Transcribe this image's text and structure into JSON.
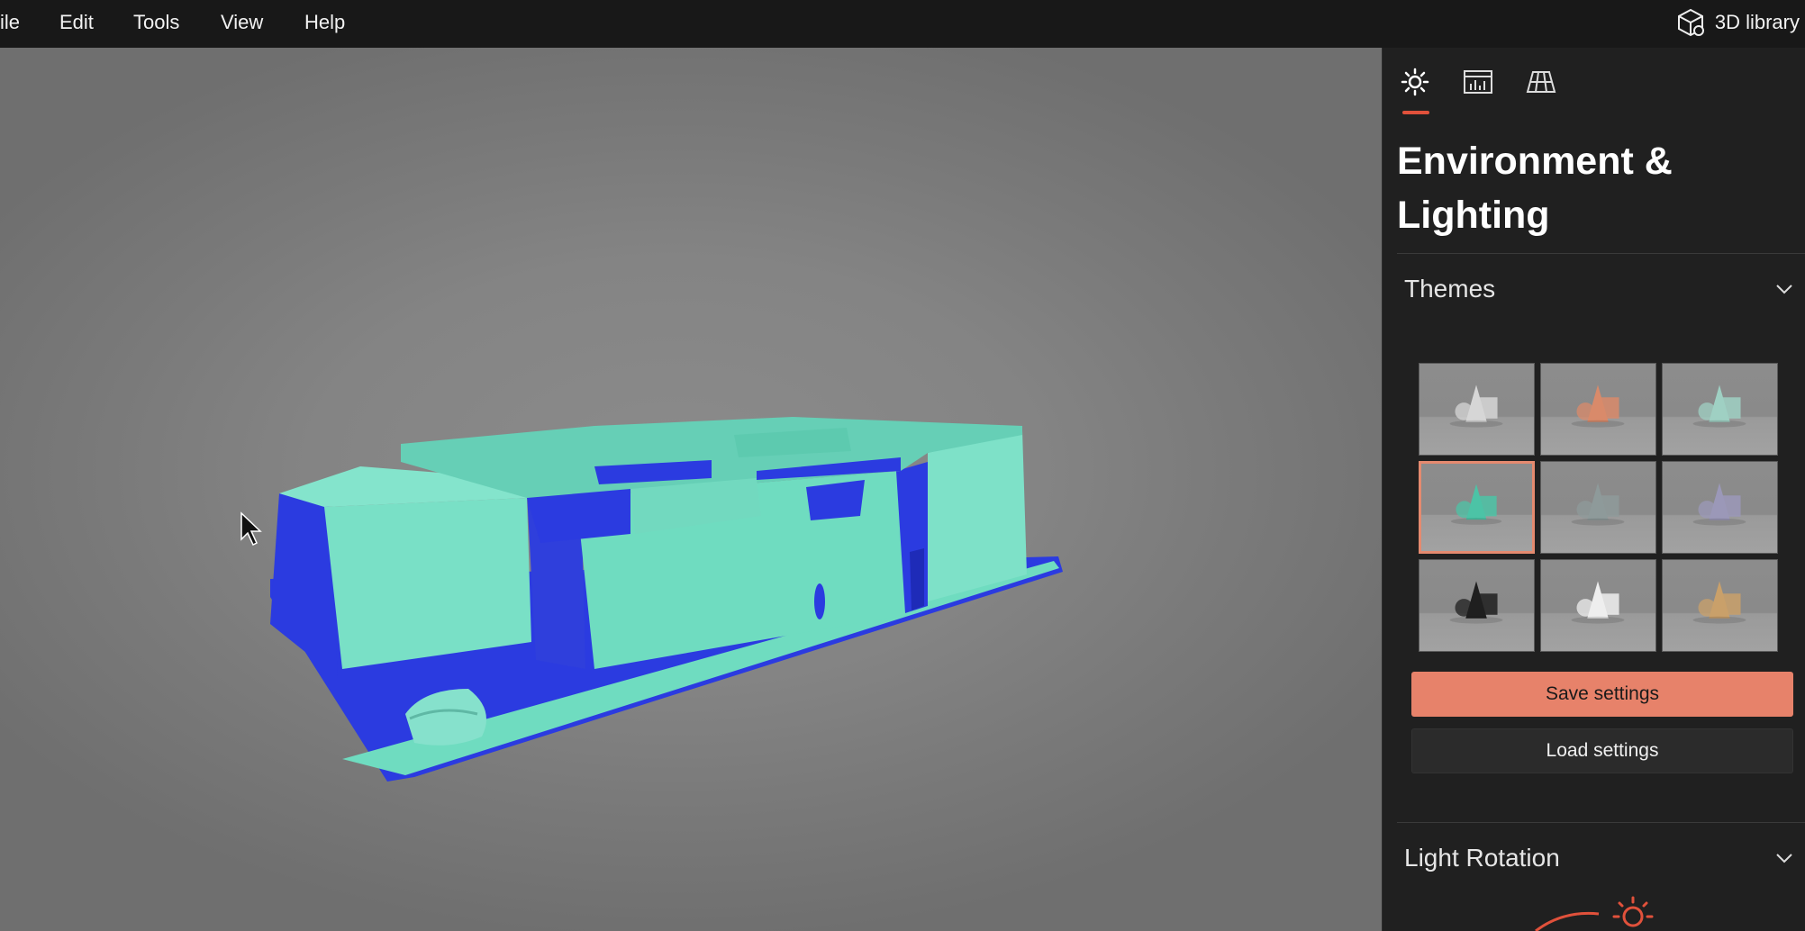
{
  "menu": {
    "items": [
      "ile",
      "Edit",
      "Tools",
      "View",
      "Help"
    ],
    "library_label": "3D library"
  },
  "panel": {
    "tabs": [
      {
        "icon": "sun-icon",
        "active": true
      },
      {
        "icon": "stats-icon",
        "active": false
      },
      {
        "icon": "grid-icon",
        "active": false
      }
    ],
    "title": "Environment & Lighting",
    "themes": {
      "label": "Themes",
      "selected_index": 3,
      "items": [
        {
          "shapes_color": "#d6d6d6"
        },
        {
          "shapes_color": "#d98a6a"
        },
        {
          "shapes_color": "#9fd0c3"
        },
        {
          "shapes_color": "#4cc3a6"
        },
        {
          "shapes_color": "#8e9a9a"
        },
        {
          "shapes_color": "#9b98b8"
        },
        {
          "shapes_color": "#1f1f1f"
        },
        {
          "shapes_color": "#eeeeee"
        },
        {
          "shapes_color": "#c9a06a"
        }
      ]
    },
    "save_label": "Save settings",
    "load_label": "Load settings",
    "light_rotation_label": "Light Rotation"
  },
  "colors": {
    "accent": "#e1513b",
    "save_button": "#e7826a",
    "model_main": "#6fdcc0",
    "model_shadow": "#2b3be0"
  }
}
